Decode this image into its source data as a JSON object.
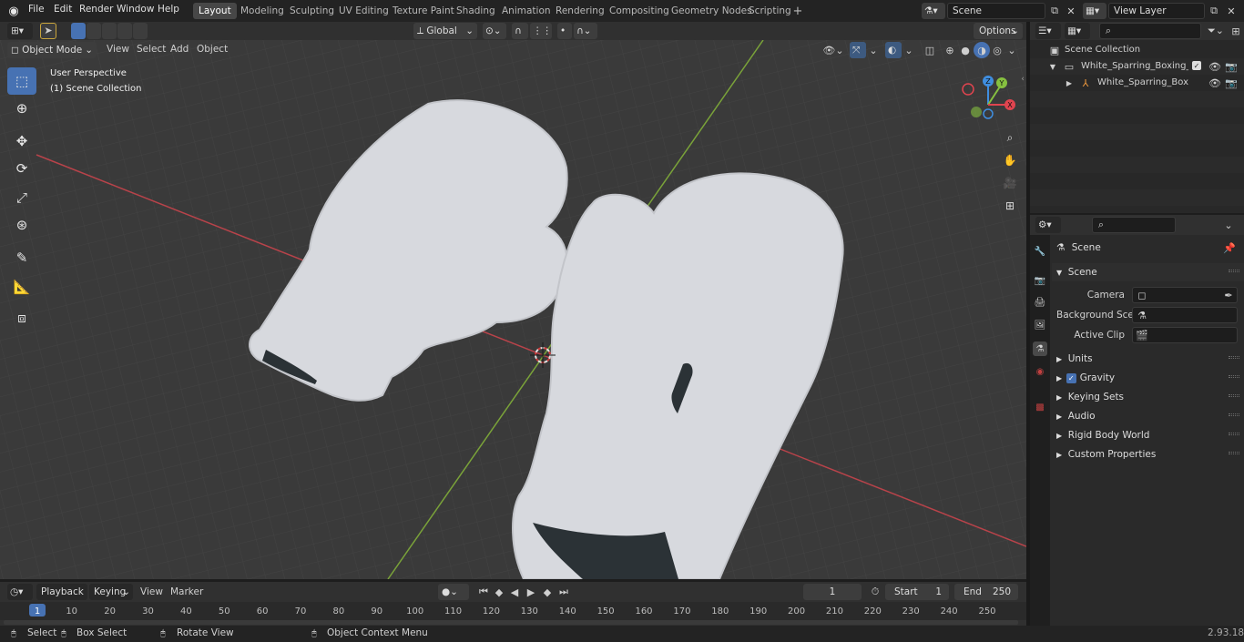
{
  "topbar": {
    "menus": [
      "File",
      "Edit",
      "Render",
      "Window",
      "Help"
    ],
    "workspace_tabs": [
      "Layout",
      "Modeling",
      "Sculpting",
      "UV Editing",
      "Texture Paint",
      "Shading",
      "Animation",
      "Rendering",
      "Compositing",
      "Geometry Nodes",
      "Scripting"
    ],
    "add_tab": "+",
    "scene_name": "Scene",
    "view_layer": "View Layer"
  },
  "header": {
    "transform_orientation": "Global",
    "options_label": "Options",
    "mode": "Object Mode",
    "view_menu": "View",
    "select_menu": "Select",
    "add_menu": "Add",
    "object_menu": "Object"
  },
  "viewport": {
    "perspective_label": "User Perspective",
    "collection_label": "(1) Scene Collection",
    "gizmo": {
      "x": "X",
      "y": "Y",
      "z": "Z"
    }
  },
  "outliner": {
    "items": [
      {
        "label": "Scene Collection"
      },
      {
        "label": "White_Sparring_Boxing_Glove"
      },
      {
        "label": "White_Sparring_Boxing_("
      }
    ]
  },
  "properties": {
    "context_title": "Scene",
    "panel_title": "Scene",
    "fields": [
      {
        "label": "Camera"
      },
      {
        "label": "Background Scene"
      },
      {
        "label": "Active Clip"
      }
    ],
    "subpanels": [
      "Units",
      "Gravity",
      "Keying Sets",
      "Audio",
      "Rigid Body World",
      "Custom Properties"
    ],
    "gravity_checked": true
  },
  "timeline": {
    "playback": "Playback",
    "keying": "Keying",
    "view": "View",
    "marker": "Marker",
    "current_frame": "1",
    "start_label": "Start",
    "start_value": "1",
    "end_label": "End",
    "end_value": "250",
    "ruler": [
      "1",
      "10",
      "20",
      "30",
      "40",
      "50",
      "60",
      "70",
      "80",
      "90",
      "100",
      "110",
      "120",
      "130",
      "140",
      "150",
      "160",
      "170",
      "180",
      "190",
      "200",
      "210",
      "220",
      "230",
      "240",
      "250"
    ]
  },
  "statusbar": {
    "select": "Select",
    "box_select": "Box Select",
    "rotate_view": "Rotate View",
    "context_menu": "Object Context Menu",
    "version": "2.93.18"
  },
  "colors": {
    "accent": "#4772b3",
    "axis_x": "#e0444f",
    "axis_y": "#86c040",
    "axis_z": "#3f8ee0",
    "frame_marker": "#4772b3"
  }
}
